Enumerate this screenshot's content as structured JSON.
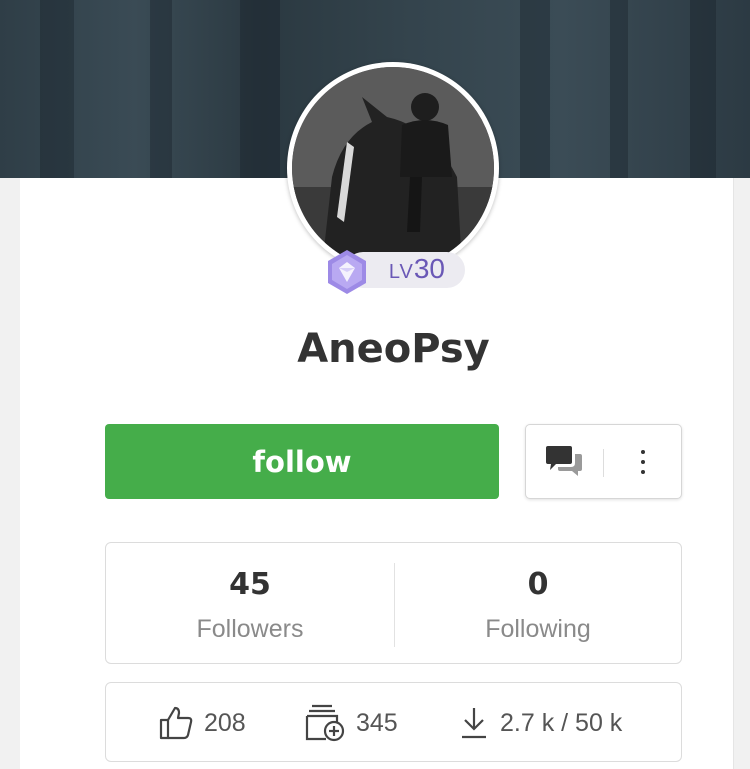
{
  "profile": {
    "username": "AneoPsy",
    "level_prefix": "LV",
    "level_value": "30"
  },
  "actions": {
    "follow_label": "follow"
  },
  "stats": {
    "followers_count": "45",
    "followers_label": "Followers",
    "following_count": "0",
    "following_label": "Following"
  },
  "metrics": {
    "likes": "208",
    "collections": "345",
    "downloads": "2.7 k / 50 k"
  },
  "icons": {
    "level_badge": "hexagon-gem-icon",
    "message": "chat-bubbles-icon",
    "more": "vertical-dots-icon",
    "likes": "thumbs-up-icon",
    "collections": "add-collection-icon",
    "downloads": "download-icon"
  },
  "colors": {
    "follow_green": "#45ad4a",
    "level_purple": "#6a58b6",
    "banner": "#34444d"
  }
}
